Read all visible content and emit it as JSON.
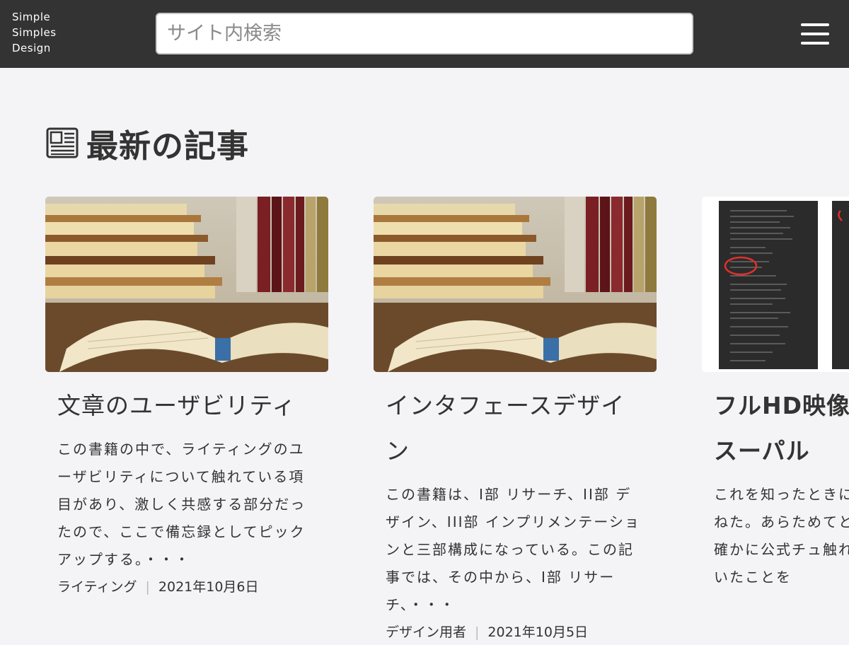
{
  "header": {
    "logo_lines": [
      "Simple",
      "Simples",
      "Design"
    ],
    "search_placeholder": "サイト内検索"
  },
  "section": {
    "title": "最新の記事",
    "icon": "newspaper-icon"
  },
  "articles": [
    {
      "title": "文章のユーザビリティ",
      "excerpt": "この書籍の中で、ライティングのユーザビリティについて触れている項目があり、激しく共感する部分だったので、ここで備忘録としてピックアップする。・・・",
      "category": "ライティング",
      "date": "2021年10月6日",
      "thumbnail": "books-photo"
    },
    {
      "title": "インタフェースデザイン",
      "excerpt": "この書籍は、I部 リサーチ、II部 デザイン、III部 インプリメンテーションと三部構成になっている。この記事では、その中から、I部 リサーチ、・・・",
      "category": "デザイン用者",
      "date": "2021年10月5日",
      "thumbnail": "books-photo"
    },
    {
      "title": "フルHD映像る → スーパル",
      "excerpt": "これを知ったときに跳ねた。あらためてと、確かに公式チュ触れていたことを",
      "category": "",
      "date": "",
      "thumbnail": "menu-screenshot"
    }
  ],
  "colors": {
    "header_bg": "#333333",
    "page_bg": "#f4f4f6",
    "annotation_red": "#e0302a"
  }
}
